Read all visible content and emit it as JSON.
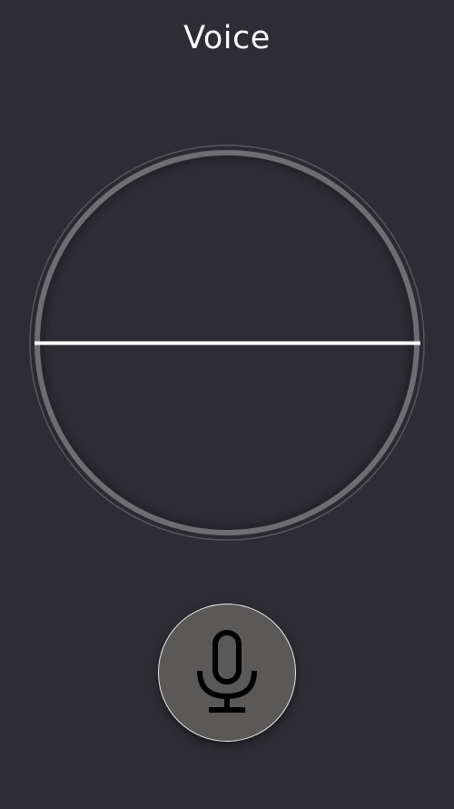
{
  "header": {
    "title": "Voice"
  },
  "waveform": {
    "ring_color": "#6e6d72",
    "outer_ring_color": "#58575c",
    "line_color": "#ffffff",
    "level": 0
  },
  "mic_button": {
    "icon": "microphone-icon",
    "fill_color": "#5a5958",
    "border_color": "#e6e6e6",
    "icon_color": "#000000"
  },
  "colors": {
    "background": "#2e2d33",
    "title": "#ffffff"
  }
}
